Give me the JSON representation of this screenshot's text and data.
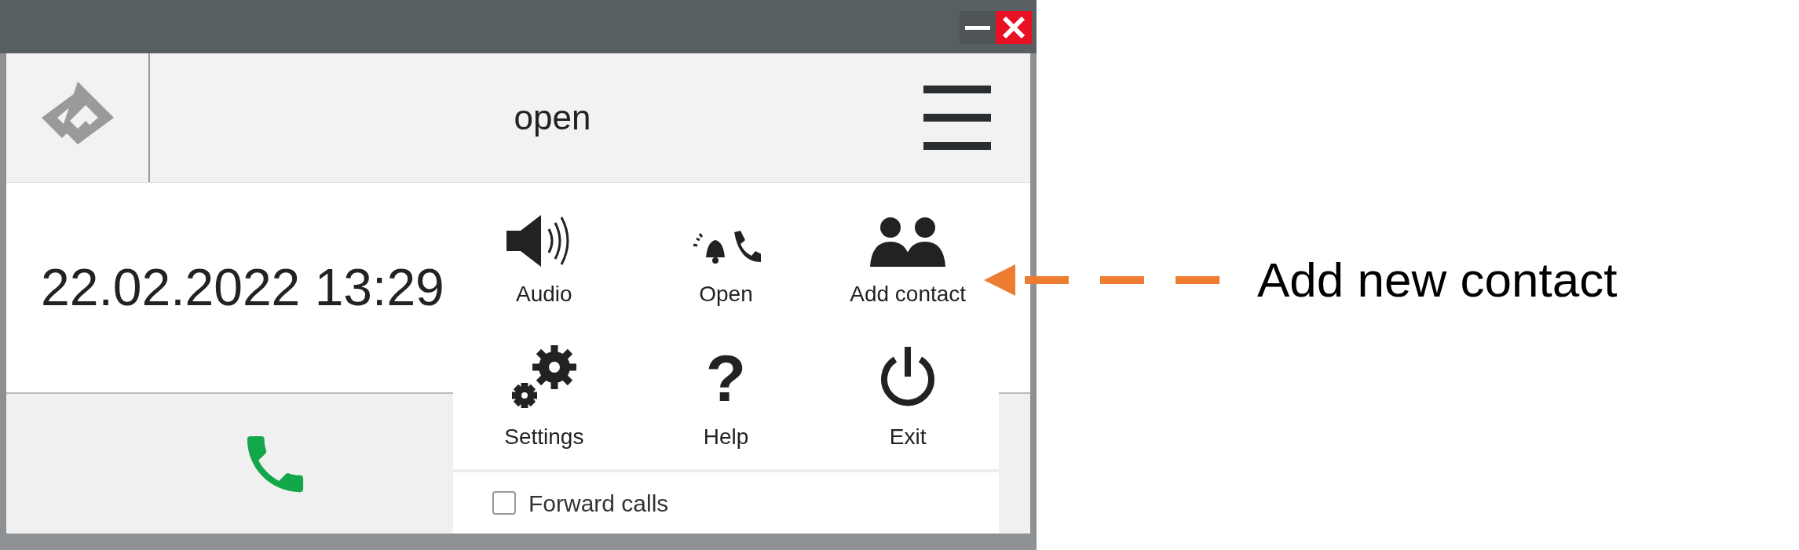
{
  "header": {
    "title": "open"
  },
  "datetime": "22.02.2022 13:29",
  "menu": {
    "items": [
      {
        "kind": "audio",
        "label": "Audio"
      },
      {
        "kind": "open",
        "label": "Open"
      },
      {
        "kind": "add_contact",
        "label": "Add contact"
      },
      {
        "kind": "settings",
        "label": "Settings"
      },
      {
        "kind": "help",
        "label": "Help",
        "glyph": "?"
      },
      {
        "kind": "exit",
        "label": "Exit"
      }
    ],
    "forward": {
      "label": "Forward calls",
      "checked": false
    }
  },
  "annotation": {
    "text": "Add new contact"
  }
}
